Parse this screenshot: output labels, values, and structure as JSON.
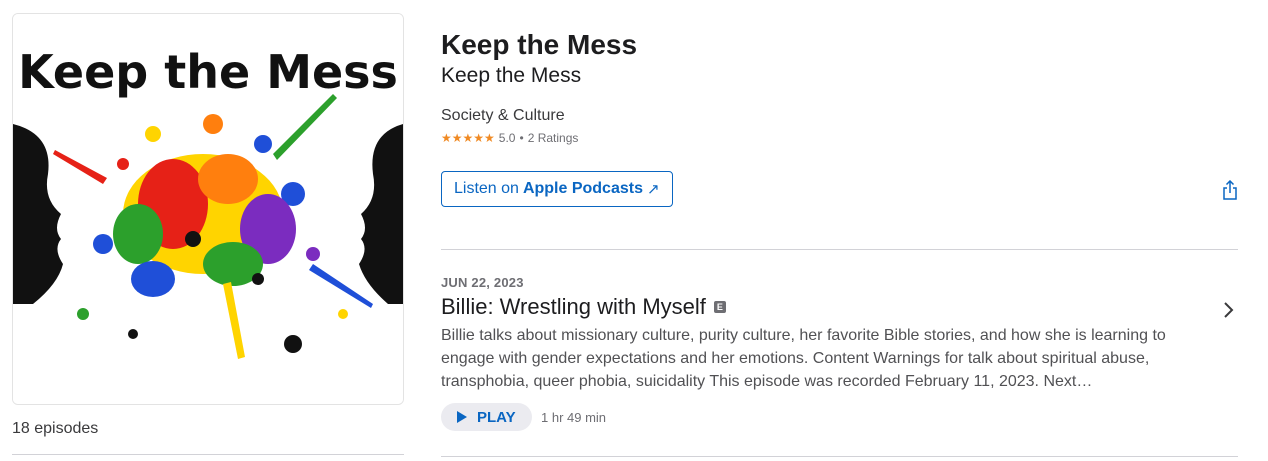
{
  "artwork": {
    "title_text": "Keep the Mess",
    "palette": [
      "#e62117",
      "#ff7f0e",
      "#ffd400",
      "#2ca02c",
      "#1f4fd8",
      "#7b2cbf",
      "#111111"
    ]
  },
  "podcast": {
    "title": "Keep the Mess",
    "author": "Keep the Mess",
    "category": "Society & Culture",
    "stars": "★★★★★",
    "rating_value": "5.0",
    "rating_separator": "•",
    "rating_count": "2 Ratings",
    "episodes_count": "18 episodes"
  },
  "listen_button": {
    "prefix": "Listen on",
    "brand": "Apple Podcasts",
    "arrow": "↗"
  },
  "icons": {
    "share": "share-icon",
    "chevron": "chevron-right-icon",
    "play": "play-icon",
    "explicit": "explicit-badge"
  },
  "episode": {
    "date": "JUN 22, 2023",
    "title": "Billie: Wrestling with Myself",
    "explicit_label": "E",
    "description": "Billie talks about missionary culture, purity culture, her favorite Bible stories, and how she is learning to engage with gender expectations and her emotions. Content Warnings for talk about spiritual abuse, transphobia, queer phobia, suicidality This episode was recorded February 11, 2023. Next…",
    "play_label": "PLAY",
    "duration": "1 hr 49 min"
  },
  "colors": {
    "accent": "#0a66c2",
    "star": "#f08a24",
    "text_primary": "#1d1d1f",
    "text_secondary": "#6e6e73",
    "divider": "#d2d2d7"
  }
}
